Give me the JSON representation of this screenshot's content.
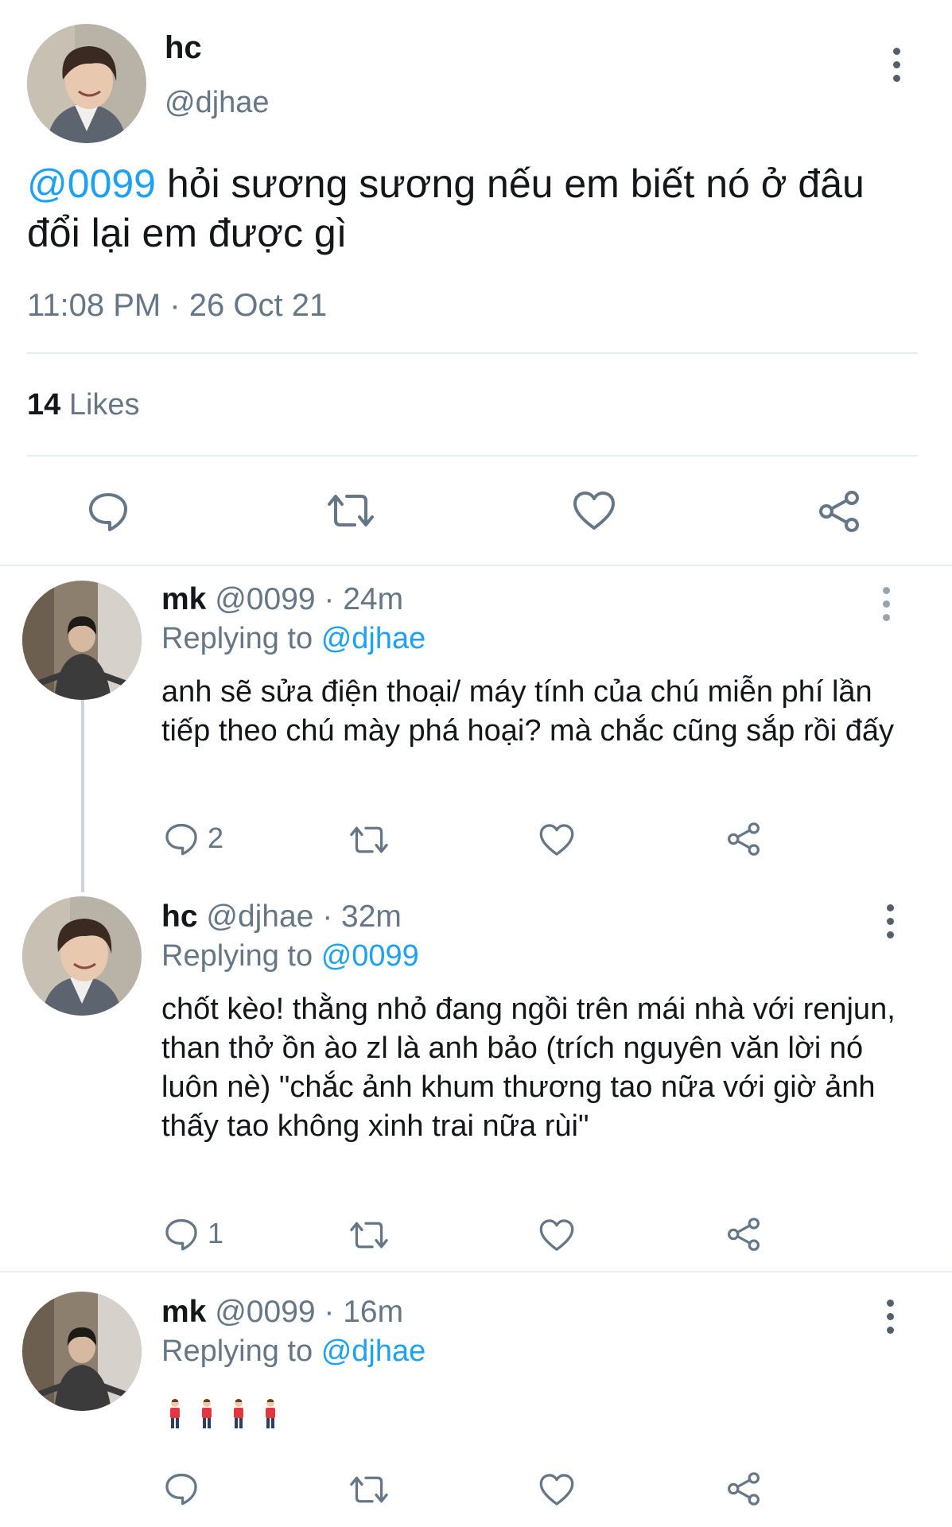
{
  "main_tweet": {
    "display_name": "hc",
    "handle": "@djhae",
    "mention": "@0099",
    "text": " hỏi sương sương nếu em biết nó ở đâu đổi lại em được gì",
    "timestamp": "11:08 PM · 26 Oct 21",
    "likes_count": "14",
    "likes_label": "Likes"
  },
  "replies": [
    {
      "display_name": "mk",
      "handle_time": "@0099 · 24m",
      "replying_label": "Replying to",
      "replying_to": "@djhae",
      "text": "anh sẽ sửa điện thoại/ máy tính của chú miễn phí lần tiếp theo chú mày phá hoại? mà chắc cũng sắp rồi đấy",
      "reply_count": "2"
    },
    {
      "display_name": "hc",
      "handle_time": "@djhae · 32m",
      "replying_label": "Replying to",
      "replying_to": "@0099",
      "text": "chốt kèo! thằng nhỏ đang ngồi trên mái nhà với renjun, than thở ồn ào zl là anh bảo (trích nguyên văn lời nó luôn nè) \"chắc ảnh khum thương tao nữa với giờ ảnh thấy tao không xinh trai nữa rùi\"",
      "reply_count": "1"
    },
    {
      "display_name": "mk",
      "handle_time": "@0099 · 16m",
      "replying_label": "Replying to",
      "replying_to": "@djhae",
      "emoji_count": 4
    }
  ],
  "icons": [
    "reply-icon",
    "retweet-icon",
    "like-icon",
    "share-icon",
    "more-icon",
    "standing-person-emoji"
  ],
  "colors": {
    "link": "#1da1f2",
    "secondary": "#657786",
    "divider": "#e6ecf0"
  }
}
